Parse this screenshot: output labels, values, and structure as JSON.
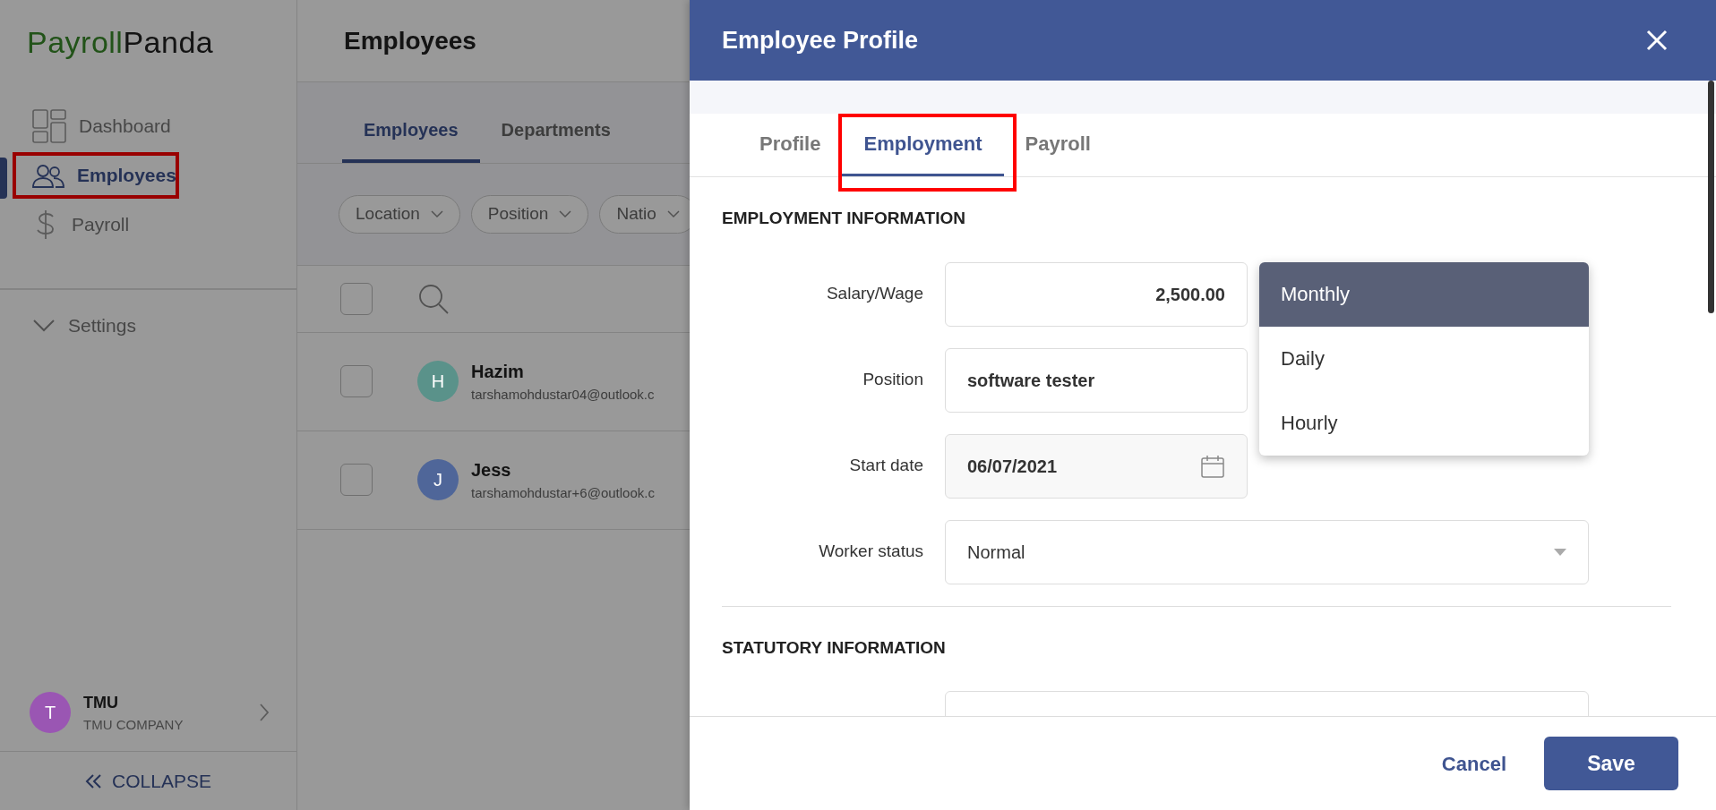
{
  "sidebar": {
    "logo": {
      "first": "Payroll",
      "second": "Panda"
    },
    "nav": [
      {
        "label": "Dashboard",
        "selected": false,
        "highlighted": false
      },
      {
        "label": "Employees",
        "selected": true,
        "highlighted": true
      },
      {
        "label": "Payroll",
        "selected": false,
        "highlighted": false
      }
    ],
    "settings": {
      "label": "Settings",
      "expanded": false
    },
    "user": {
      "initial": "T",
      "name": "TMU",
      "company": "TMU COMPANY",
      "color": "#9a56b3"
    },
    "collapse": "COLLAPSE"
  },
  "page": {
    "title": "Employees",
    "tabs": [
      {
        "label": "Employees",
        "selected": true
      },
      {
        "label": "Departments",
        "selected": false
      }
    ],
    "filters": [
      "Location",
      "Position",
      "Natio"
    ],
    "select_all": {
      "checked": false
    },
    "employees": [
      {
        "initial": "H",
        "name": "Hazim",
        "email": "tarshamohdustar04@outlook.c",
        "color": "#5a928a",
        "checked": false
      },
      {
        "initial": "J",
        "name": "Jess",
        "email": "tarshamohdustar+6@outlook.c",
        "color": "#4f6699",
        "checked": false
      }
    ]
  },
  "drawer": {
    "title": "Employee Profile",
    "tabs": [
      {
        "label": "Profile",
        "selected": false,
        "highlighted": false
      },
      {
        "label": "Employment",
        "selected": true,
        "highlighted": true
      },
      {
        "label": "Payroll",
        "selected": false,
        "highlighted": false
      }
    ],
    "sections": [
      {
        "heading": "EMPLOYMENT INFORMATION",
        "fields": [
          {
            "kind": "amount",
            "label": "Salary/Wage",
            "value": "2,500.00"
          },
          {
            "kind": "text",
            "label": "Position",
            "value": "software tester"
          },
          {
            "kind": "date",
            "label": "Start date",
            "value": "06/07/2021"
          },
          {
            "kind": "select",
            "label": "Worker status",
            "value": "Normal"
          }
        ]
      },
      {
        "heading": "STATUTORY INFORMATION",
        "fields": [
          {
            "kind": "partial"
          }
        ]
      }
    ],
    "pay_period_menu": [
      {
        "label": "Monthly",
        "selected": true
      },
      {
        "label": "Daily",
        "selected": false
      },
      {
        "label": "Hourly",
        "selected": false
      }
    ],
    "buttons": {
      "cancel": "Cancel",
      "save": "Save"
    }
  }
}
